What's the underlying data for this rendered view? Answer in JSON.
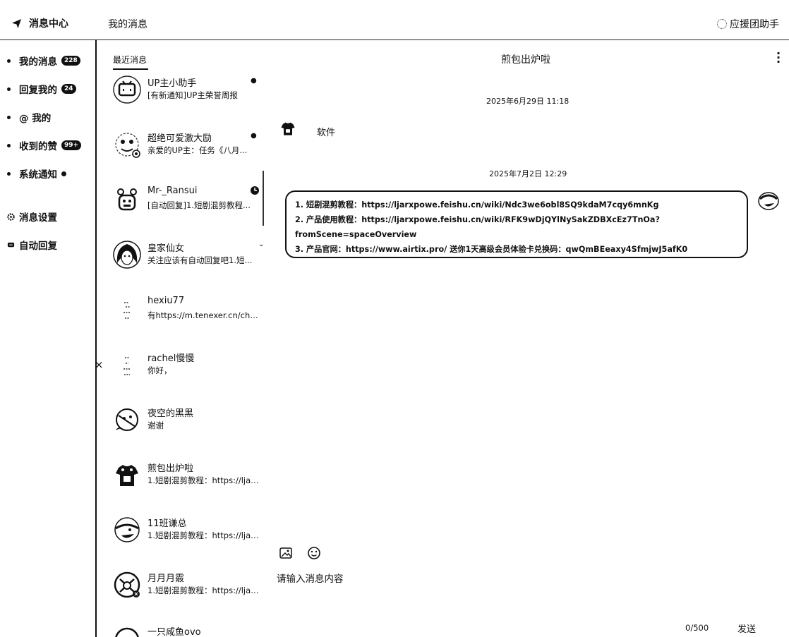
{
  "brand": {
    "title": "消息中心",
    "icon": "paper-plane-icon"
  },
  "header": {
    "page_title": "我的消息",
    "helper_label": "应援团助手"
  },
  "sidebar": {
    "items": [
      {
        "label": "我的消息",
        "badge": "228"
      },
      {
        "label": "回复我的",
        "badge": "24"
      },
      {
        "label": "@ 我的"
      },
      {
        "label": "收到的赞",
        "badge": "99+"
      },
      {
        "label": "系统通知"
      }
    ],
    "settings": [
      {
        "label": "消息设置",
        "icon": "gear-icon"
      },
      {
        "label": "自动回复",
        "icon": "chat-bubble-icon"
      }
    ]
  },
  "conversation_list": {
    "header": "最近消息",
    "items": [
      {
        "name": "UP主小助手",
        "preview": "[有新通知]UP主荣誉周报"
      },
      {
        "name": "超绝可爱激大励",
        "preview": "亲爱的UP主：任务《八月..."
      },
      {
        "name": "Mr-_Ransui",
        "preview": "[自动回复]1.短剧混剪教程..."
      },
      {
        "name": "皇家仙女",
        "preview": "关注应该有自动回复吧1.短..."
      },
      {
        "name": "hexiu77",
        "preview": "有https://m.tenexer.cn/chan..."
      },
      {
        "name": "rachel慢慢",
        "preview": "你好，"
      },
      {
        "name": "夜空的黑黑",
        "preview": "谢谢"
      },
      {
        "name": "煎包出炉啦",
        "preview": "1.短剧混剪教程：https://ljar..."
      },
      {
        "name": "11班谦总",
        "preview": "1.短剧混剪教程：https://ljar..."
      },
      {
        "name": "月月月霰",
        "preview": "1.短剧混剪教程：https://ljar..."
      },
      {
        "name": "一只咸鱼ovo",
        "preview": ""
      }
    ]
  },
  "chat": {
    "title": "煎包出炉啦",
    "messages": [
      {
        "time": "2025年6月29日 11:18",
        "text": "软件"
      },
      {
        "time": "2025年7月2日 12:29",
        "lines": [
          "1. 短剧混剪教程：https://ljarxpowe.feishu.cn/wiki/Ndc3we6obl8SQ9kdaM7cqy6mnKg",
          "2. 产品使用教程：https://ljarxpowe.feishu.cn/wiki/RFK9wDjQYlNySakZDBXcEz7TnOa?",
          "fromScene=spaceOverview",
          "3. 产品官网：https://www.airtix.pro/ 送你1天高级会员体验卡兑换码：qwQmBEeaxy4SfmjwJ5afK0"
        ]
      }
    ],
    "input_placeholder": "请输入消息内容",
    "counter": "0/500",
    "send_label": "发送"
  }
}
